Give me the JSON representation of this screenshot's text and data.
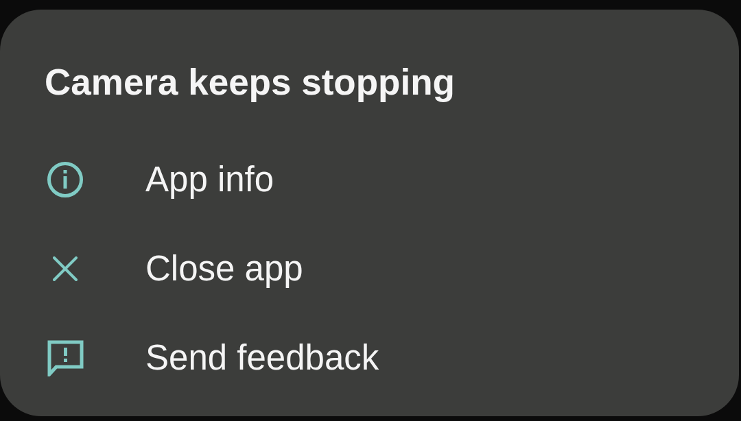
{
  "dialog": {
    "title": "Camera keeps stopping",
    "actions": [
      {
        "kind": "info",
        "label": "App info"
      },
      {
        "kind": "close",
        "label": "Close app"
      },
      {
        "kind": "feedback",
        "label": "Send feedback"
      }
    ]
  }
}
